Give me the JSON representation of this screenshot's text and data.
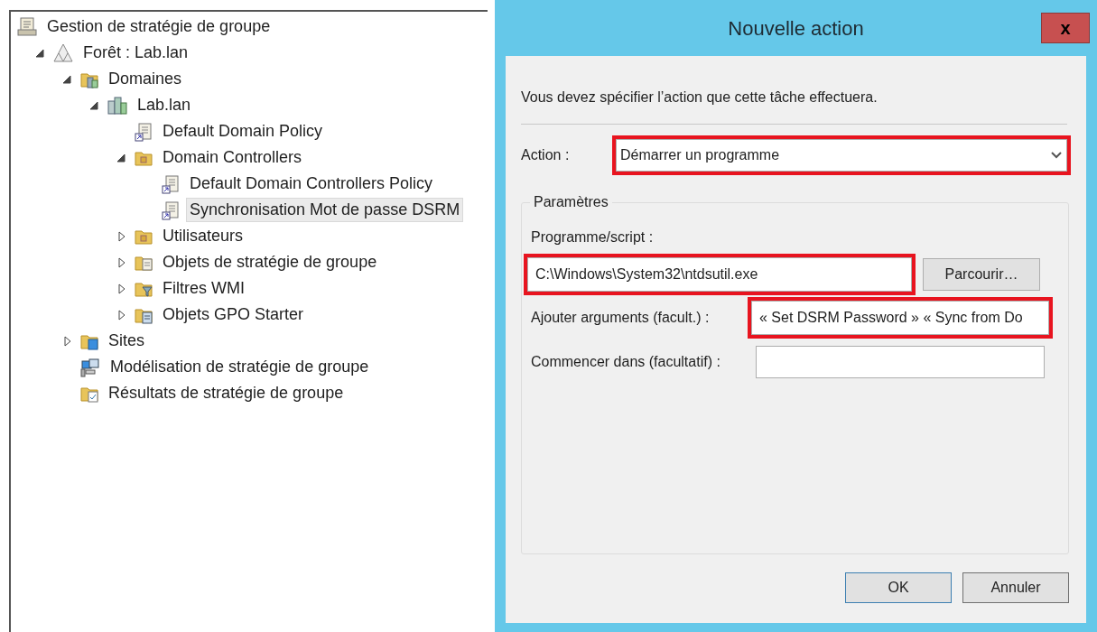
{
  "tree": [
    {
      "label": "Gestion de stratégie de groupe",
      "kind": "console",
      "selected": false,
      "children": [
        {
          "label": "Forêt : Lab.lan",
          "kind": "forest",
          "expanded": true,
          "selected": false,
          "children": [
            {
              "label": "Domaines",
              "kind": "domains",
              "expanded": true,
              "selected": false,
              "children": [
                {
                  "label": "Lab.lan",
                  "kind": "domain",
                  "expanded": true,
                  "selected": false,
                  "children": [
                    {
                      "label": "Default Domain Policy",
                      "kind": "gpo-link",
                      "selected": false
                    },
                    {
                      "label": "Domain Controllers",
                      "kind": "ou",
                      "expanded": true,
                      "selected": false,
                      "children": [
                        {
                          "label": "Default Domain Controllers Policy",
                          "kind": "gpo-link",
                          "selected": false
                        },
                        {
                          "label": "Synchronisation Mot de passe DSRM",
                          "kind": "gpo-link",
                          "selected": true
                        }
                      ]
                    },
                    {
                      "label": "Utilisateurs",
                      "kind": "ou",
                      "expanded": false,
                      "selected": false
                    },
                    {
                      "label": "Objets de stratégie de groupe",
                      "kind": "gpo-folder",
                      "expanded": false,
                      "selected": false
                    },
                    {
                      "label": "Filtres WMI",
                      "kind": "wmi",
                      "expanded": false,
                      "selected": false
                    },
                    {
                      "label": "Objets GPO Starter",
                      "kind": "starter",
                      "expanded": false,
                      "selected": false
                    }
                  ]
                }
              ]
            },
            {
              "label": "Sites",
              "kind": "sites",
              "expanded": false,
              "selected": false
            },
            {
              "label": "Modélisation de stratégie de groupe",
              "kind": "modeling",
              "selected": false
            },
            {
              "label": "Résultats de stratégie de groupe",
              "kind": "results",
              "selected": false
            }
          ]
        }
      ]
    }
  ],
  "dialog": {
    "title": "Nouvelle action",
    "close": "x",
    "instruction": "Vous devez spécifier l’action que cette tâche effectuera.",
    "action": {
      "label": "Action :",
      "value": "Démarrer un programme",
      "highlighted": true
    },
    "group": {
      "title": "Paramètres",
      "program": {
        "label": "Programme/script :",
        "value": "C:\\Windows\\System32\\ntdsutil.exe",
        "highlighted": true
      },
      "browse": "Parcourir…",
      "arguments": {
        "label": "Ajouter arguments (facult.) :",
        "value": "« Set DSRM Password » « Sync from Do",
        "highlighted": true
      },
      "start_in": {
        "label": "Commencer dans (facultatif) :",
        "highlighted": false
      }
    },
    "buttons": [
      {
        "label": "OK",
        "default": true
      },
      {
        "label": "Annuler",
        "default": false
      }
    ]
  }
}
